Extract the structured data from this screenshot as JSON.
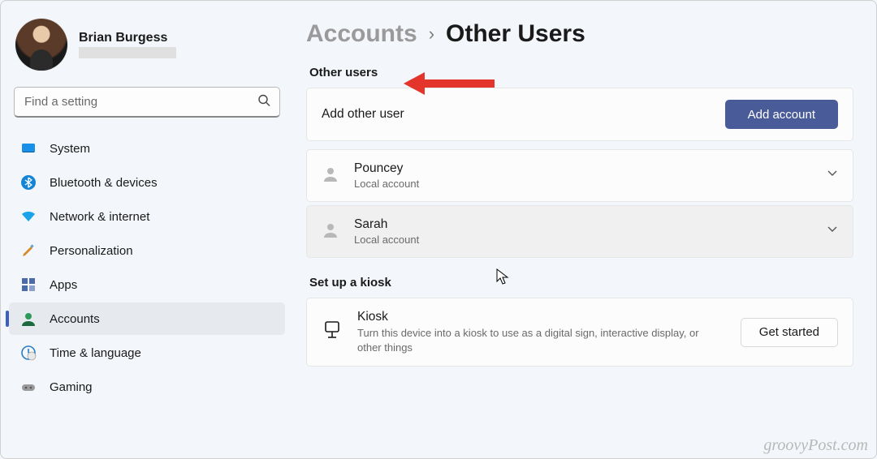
{
  "profile": {
    "name": "Brian Burgess"
  },
  "search": {
    "placeholder": "Find a setting"
  },
  "sidebar": {
    "items": [
      {
        "label": "System"
      },
      {
        "label": "Bluetooth & devices"
      },
      {
        "label": "Network & internet"
      },
      {
        "label": "Personalization"
      },
      {
        "label": "Apps"
      },
      {
        "label": "Accounts"
      },
      {
        "label": "Time & language"
      },
      {
        "label": "Gaming"
      }
    ],
    "selected_index": 5
  },
  "breadcrumb": {
    "parent": "Accounts",
    "separator": "›",
    "current": "Other Users"
  },
  "sections": {
    "other_users": {
      "heading": "Other users",
      "add_row": {
        "label": "Add other user",
        "button": "Add account"
      },
      "users": [
        {
          "name": "Pouncey",
          "type": "Local account"
        },
        {
          "name": "Sarah",
          "type": "Local account"
        }
      ]
    },
    "kiosk": {
      "heading": "Set up a kiosk",
      "row": {
        "title": "Kiosk",
        "description": "Turn this device into a kiosk to use as a digital sign, interactive display, or other things",
        "button": "Get started"
      }
    }
  },
  "watermark": "groovyPost.com"
}
